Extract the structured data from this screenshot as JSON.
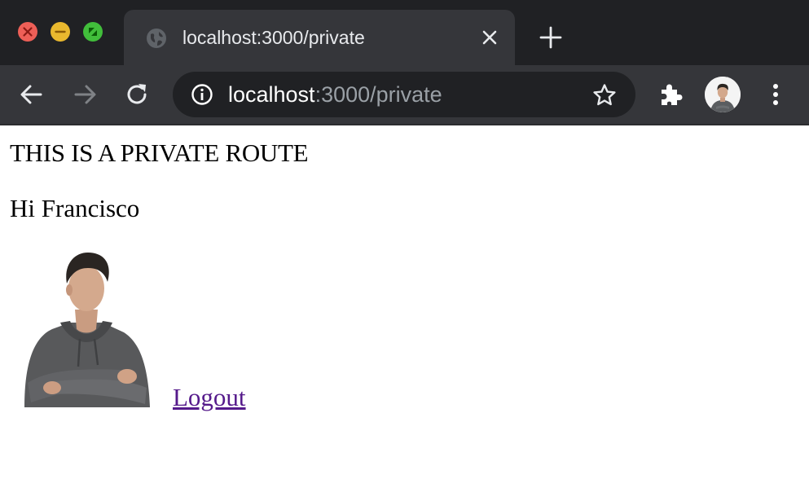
{
  "browser": {
    "tab": {
      "title": "localhost:3000/private",
      "favicon": "globe-icon"
    },
    "omnibox": {
      "host": "localhost",
      "path": ":3000/private"
    },
    "colors": {
      "tabstrip": "#202124",
      "toolbar": "#35363a",
      "omnibox": "#202124",
      "close": "#ee5f57",
      "minimize": "#e9b82e",
      "maximize": "#41be3b"
    }
  },
  "page": {
    "heading": "THIS IS A PRIVATE ROUTE",
    "greeting": "Hi Francisco",
    "logout_label": "Logout",
    "link_color": "#551a8b"
  }
}
